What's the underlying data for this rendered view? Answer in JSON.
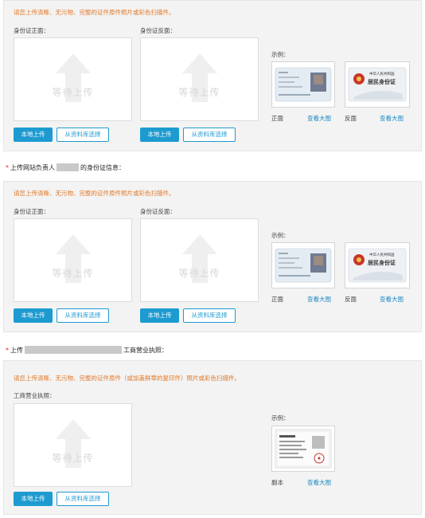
{
  "upload": {
    "placeholder": "等待上传",
    "local_button": "本地上传",
    "library_button": "从资料库选择"
  },
  "example": {
    "title": "示例：",
    "view_large": "查看大图"
  },
  "id_front_label": "身份证正面：",
  "id_back_label": "身份证反面：",
  "caption_front": "正面",
  "caption_back": "反面",
  "caption_copy": "副本",
  "id_card_emblem_text": "中华人民共和国",
  "id_card_title": "居民身份证",
  "section1": {
    "notice": "请您上传清晰、无污物、完整的证件原件照片或彩色扫描件。"
  },
  "section2": {
    "title_prefix": "上传网站负责人",
    "title_suffix": "的身份证信息：",
    "notice": "请您上传清晰、无污物、完整的证件原件照片或彩色扫描件。"
  },
  "section3": {
    "title_prefix": "上传",
    "title_suffix": "工商营业执照：",
    "notice": "请您上传清晰、无污物、完整的证件原件（或加盖鲜章的复印件）照片或彩色扫描件。",
    "field_label": "工商营业执照："
  },
  "colors": {
    "accent": "#1d9bd1",
    "notice": "#e0782a",
    "required": "#e0262b",
    "panel": "#f3f3f3"
  }
}
